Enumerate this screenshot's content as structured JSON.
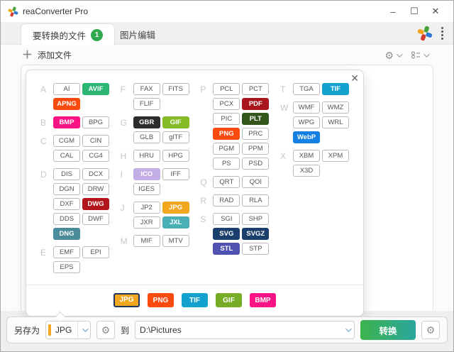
{
  "window": {
    "title": "reaConverter Pro",
    "controls": {
      "minimize": "–",
      "maximize": "☐",
      "close": "✕"
    }
  },
  "tabs": {
    "files": {
      "label": "要转换的文件",
      "badge": "1"
    },
    "edit": {
      "label": "图片编辑"
    }
  },
  "toolbar": {
    "add_files": "添加文件",
    "plus": "＋"
  },
  "dialog": {
    "close": "✕",
    "columns": [
      {
        "groups": [
          {
            "letter": "A",
            "rows": [
              [
                {
                  "label": "AI"
                },
                {
                  "label": "AVIF",
                  "style": "green"
                }
              ],
              [
                {
                  "label": "APNG",
                  "style": "orangered"
                }
              ]
            ]
          },
          {
            "letter": "B",
            "rows": [
              [
                {
                  "label": "BMP",
                  "style": "pink"
                },
                {
                  "label": "BPG"
                }
              ]
            ]
          },
          {
            "letter": "C",
            "rows": [
              [
                {
                  "label": "CGM"
                },
                {
                  "label": "CIN"
                }
              ],
              [
                {
                  "label": "CAL"
                },
                {
                  "label": "CG4"
                }
              ]
            ]
          },
          {
            "letter": "D",
            "rows": [
              [
                {
                  "label": "DIS"
                },
                {
                  "label": "DCX"
                }
              ],
              [
                {
                  "label": "DGN"
                },
                {
                  "label": "DRW"
                }
              ],
              [
                {
                  "label": "DXF"
                },
                {
                  "label": "DWG",
                  "style": "darkred"
                }
              ],
              [
                {
                  "label": "DDS"
                },
                {
                  "label": "DWF"
                }
              ],
              [
                {
                  "label": "DNG",
                  "style": "steel"
                }
              ]
            ]
          },
          {
            "letter": "E",
            "rows": [
              [
                {
                  "label": "EMF"
                },
                {
                  "label": "EPI"
                }
              ],
              [
                {
                  "label": "EPS"
                }
              ]
            ]
          }
        ]
      },
      {
        "groups": [
          {
            "letter": "F",
            "rows": [
              [
                {
                  "label": "FAX"
                },
                {
                  "label": "FITS"
                }
              ],
              [
                {
                  "label": "FLIF"
                }
              ]
            ]
          },
          {
            "letter": "G",
            "rows": [
              [
                {
                  "label": "GBR",
                  "style": "charcoal"
                },
                {
                  "label": "GIF",
                  "style": "lime"
                }
              ],
              [
                {
                  "label": "GLB"
                },
                {
                  "label": "glTF"
                }
              ]
            ]
          },
          {
            "letter": "H",
            "rows": [
              [
                {
                  "label": "HRU"
                },
                {
                  "label": "HPG"
                }
              ]
            ]
          },
          {
            "letter": "I",
            "rows": [
              [
                {
                  "label": "ICO",
                  "style": "lavender"
                },
                {
                  "label": "IFF"
                }
              ],
              [
                {
                  "label": "IGES"
                }
              ]
            ]
          },
          {
            "letter": "J",
            "rows": [
              [
                {
                  "label": "JP2"
                },
                {
                  "label": "JPG",
                  "style": "amber"
                }
              ],
              [
                {
                  "label": "JXR"
                },
                {
                  "label": "JXL",
                  "style": "teal"
                }
              ]
            ]
          },
          {
            "letter": "M",
            "rows": [
              [
                {
                  "label": "MIF"
                },
                {
                  "label": "MTV"
                }
              ]
            ]
          }
        ]
      },
      {
        "groups": [
          {
            "letter": "P",
            "rows": [
              [
                {
                  "label": "PCL"
                },
                {
                  "label": "PCT"
                }
              ],
              [
                {
                  "label": "PCX"
                },
                {
                  "label": "PDF",
                  "style": "crimson"
                }
              ],
              [
                {
                  "label": "PIC"
                },
                {
                  "label": "PLT",
                  "style": "darkgreen"
                }
              ],
              [
                {
                  "label": "PNG",
                  "style": "orangered"
                },
                {
                  "label": "PRC"
                }
              ],
              [
                {
                  "label": "PGM"
                },
                {
                  "label": "PPM"
                }
              ],
              [
                {
                  "label": "PS"
                },
                {
                  "label": "PSD"
                }
              ]
            ]
          },
          {
            "letter": "Q",
            "rows": [
              [
                {
                  "label": "QRT"
                },
                {
                  "label": "QOI"
                }
              ]
            ]
          },
          {
            "letter": "R",
            "rows": [
              [
                {
                  "label": "RAD"
                },
                {
                  "label": "RLA"
                }
              ]
            ]
          },
          {
            "letter": "S",
            "rows": [
              [
                {
                  "label": "SGI"
                },
                {
                  "label": "SHP"
                }
              ],
              [
                {
                  "label": "SVG",
                  "style": "navy"
                },
                {
                  "label": "SVGZ",
                  "style": "navy"
                }
              ],
              [
                {
                  "label": "STL",
                  "style": "indigo"
                },
                {
                  "label": "STP"
                }
              ]
            ]
          }
        ]
      },
      {
        "groups": [
          {
            "letter": "T",
            "rows": [
              [
                {
                  "label": "TGA"
                },
                {
                  "label": "TIF",
                  "style": "cyan"
                }
              ]
            ]
          },
          {
            "letter": "W",
            "rows": [
              [
                {
                  "label": "WMF"
                },
                {
                  "label": "WMZ"
                }
              ],
              [
                {
                  "label": "WPG"
                },
                {
                  "label": "WRL"
                }
              ],
              [
                {
                  "label": "WebP",
                  "style": "blue"
                }
              ]
            ]
          },
          {
            "letter": "X",
            "rows": [
              [
                {
                  "label": "XBM"
                },
                {
                  "label": "XPM"
                }
              ],
              [
                {
                  "label": "X3D"
                }
              ]
            ]
          }
        ]
      }
    ],
    "popular": [
      {
        "label": "JPG",
        "style": "amber",
        "selected": true
      },
      {
        "label": "PNG",
        "style": "orangered"
      },
      {
        "label": "TIF",
        "style": "cyan"
      },
      {
        "label": "GIF",
        "style": "lime2"
      },
      {
        "label": "BMP",
        "style": "pink"
      }
    ]
  },
  "palette": {
    "green": "#2bb673",
    "orangered": "#fa4a0e",
    "pink": "#fb1285",
    "darkred": "#b2161b",
    "steel": "#4a8c9c",
    "charcoal": "#2d2d2d",
    "lime": "#84bb26",
    "lime2": "#76ad24",
    "lavender": "#c3aee6",
    "amber": "#f3a71f",
    "teal": "#4ab0b8",
    "crimson": "#a8151b",
    "darkgreen": "#33541a",
    "cyan": "#12a2cd",
    "blue": "#1380e4",
    "navy": "#1a3f6c",
    "indigo": "#4f52b0"
  },
  "bottom_bar": {
    "save_as_label": "另存为",
    "format_value": "JPG",
    "to_label": "到",
    "destination_value": "D:\\Pictures",
    "convert_label": "转换"
  }
}
